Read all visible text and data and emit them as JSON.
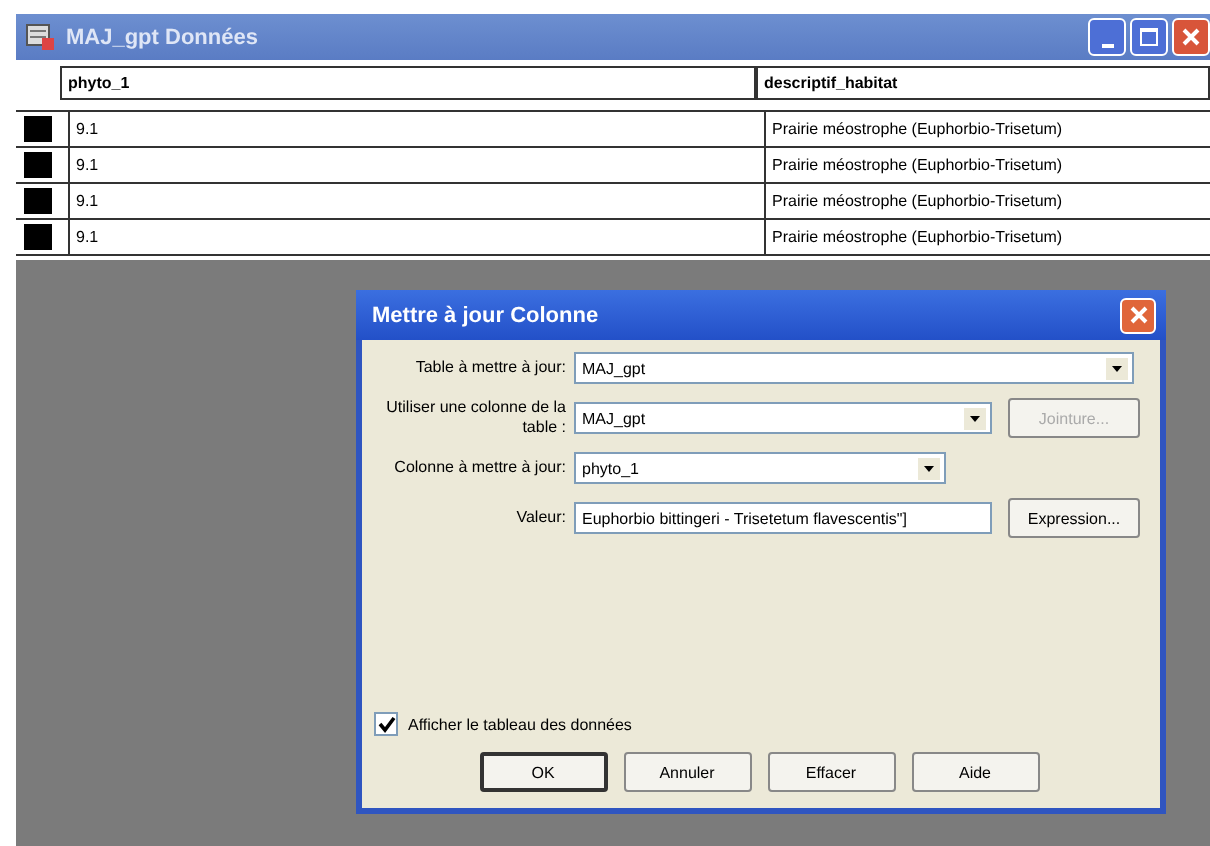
{
  "window": {
    "title": "MAJ_gpt Données"
  },
  "table": {
    "columns": [
      "phyto_1",
      "descriptif_habitat"
    ],
    "rows": [
      {
        "cells": [
          "9.1",
          "Prairie méostrophe (Euphorbio-Trisetum)"
        ]
      },
      {
        "cells": [
          "9.1",
          "Prairie méostrophe (Euphorbio-Trisetum)"
        ]
      },
      {
        "cells": [
          "9.1",
          "Prairie méostrophe (Euphorbio-Trisetum)"
        ]
      },
      {
        "cells": [
          "9.1",
          "Prairie méostrophe (Euphorbio-Trisetum)"
        ]
      }
    ]
  },
  "dialog": {
    "title": "Mettre à jour Colonne",
    "fields": [
      {
        "label": "Table à mettre à jour:",
        "value": "MAJ_gpt",
        "kind": "combo"
      },
      {
        "label": "Utiliser une colonne de la table :",
        "value": "MAJ_gpt",
        "kind": "combo",
        "button": {
          "label": "Jointure...",
          "disabled": true
        }
      },
      {
        "label": "Colonne à mettre à jour:",
        "value": "phyto_1",
        "kind": "combo"
      },
      {
        "label": "Valeur:",
        "value": "Euphorbio bittingeri - Trisetetum flavescentis\"]",
        "kind": "text",
        "button": {
          "label": "Expression...",
          "disabled": false
        }
      }
    ],
    "checkbox": {
      "label": "Afficher le tableau des données",
      "checked": true
    },
    "buttons": [
      {
        "label": "OK",
        "default": true
      },
      {
        "label": "Annuler",
        "default": false
      },
      {
        "label": "Effacer",
        "default": false
      },
      {
        "label": "Aide",
        "default": false
      }
    ]
  }
}
